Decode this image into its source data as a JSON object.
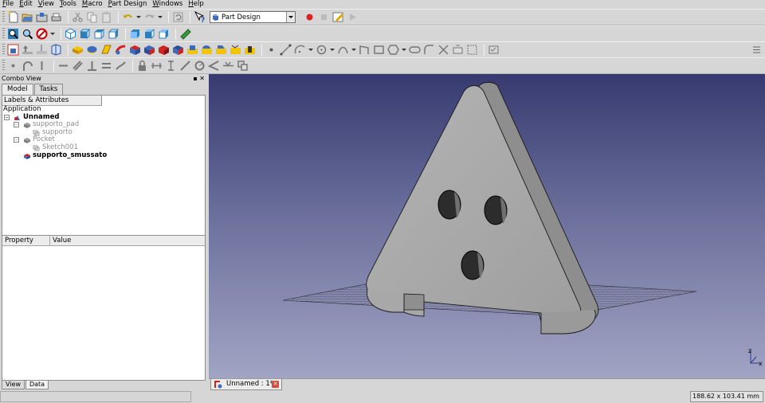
{
  "menu": [
    "File",
    "Edit",
    "View",
    "Tools",
    "Macro",
    "Part Design",
    "Windows",
    "Help"
  ],
  "workbench": {
    "selected": "Part Design"
  },
  "toolbar_icons": {
    "row1": [
      "new-document-icon",
      "open-icon",
      "save-icon",
      "print-icon",
      "cut-icon",
      "copy-icon",
      "paste-icon",
      "undo-icon",
      "redo-icon",
      "refresh-icon",
      "whats-this-icon",
      "record-macro-icon",
      "stop-macro-icon",
      "edit-macro-icon",
      "run-macro-icon"
    ],
    "row2": [
      "fit-all-icon",
      "fit-selection-icon",
      "draw-style-icon",
      "axonometric-icon",
      "front-view-icon",
      "top-view-icon",
      "right-view-icon",
      "rear-view-icon",
      "bottom-view-icon",
      "left-view-icon",
      "measure-icon"
    ],
    "row3": [
      "create-body-icon",
      "shape-binder-icon",
      "clone-icon",
      "sketch-icon",
      "pad-icon",
      "revolution-icon",
      "loft-icon",
      "pipe-icon",
      "pocket-icon",
      "hole-icon",
      "groove-icon",
      "subtractive-loft-icon",
      "subtractive-pipe-icon",
      "fillet-icon",
      "chamfer-icon",
      "draft-icon",
      "thickness-icon",
      "point-icon",
      "line-icon",
      "arc-icon",
      "circle-icon",
      "conic-icon",
      "bspline-icon",
      "polyline-icon",
      "rectangle-icon",
      "polygon-icon",
      "slot-icon",
      "fillet-sketch-icon",
      "trim-icon",
      "external-icon",
      "construction-icon",
      "validate-icon"
    ],
    "row4": [
      "constraint-point-icon",
      "constraint-tangent-icon",
      "constraint-vertical-icon",
      "constraint-horizontal-icon",
      "constraint-parallel-icon",
      "constraint-perpendicular-icon",
      "constraint-equal-icon",
      "constraint-lock-icon",
      "constraint-distance-x-icon",
      "constraint-distance-y-icon",
      "constraint-distance-icon",
      "constraint-radius-icon",
      "constraint-angle-icon",
      "constraint-symmetric-icon",
      "constraint-snell-icon",
      "toggle-driving-icon"
    ]
  },
  "combo": {
    "title": "Combo View",
    "tabs": [
      "Model",
      "Tasks"
    ],
    "tree_header": "Labels & Attributes",
    "tree": [
      {
        "label": "Application",
        "level": 0,
        "style": "normal"
      },
      {
        "label": "Unnamed",
        "level": 1,
        "style": "bold"
      },
      {
        "label": "supporto_pad",
        "level": 2,
        "style": "grey"
      },
      {
        "label": "supporto",
        "level": 3,
        "style": "grey"
      },
      {
        "label": "Pocket",
        "level": 2,
        "style": "grey"
      },
      {
        "label": "Sketch001",
        "level": 3,
        "style": "grey"
      },
      {
        "label": "supporto_smussato",
        "level": 2,
        "style": "bold"
      }
    ],
    "prop_headers": [
      "Property",
      "Value"
    ],
    "bottom_tabs": [
      "View",
      "Data"
    ]
  },
  "document_tab": "Unnamed : 1*",
  "axis_labels": [
    "z",
    "x"
  ],
  "status": {
    "dimensions": "188.62 x 103.41 mm"
  },
  "colors": {
    "bg_top": "#363a70",
    "bg_bottom": "#a2a4c4",
    "model_face": "#a7a7a7",
    "model_side": "#8c8c8c",
    "grid": "#222"
  }
}
